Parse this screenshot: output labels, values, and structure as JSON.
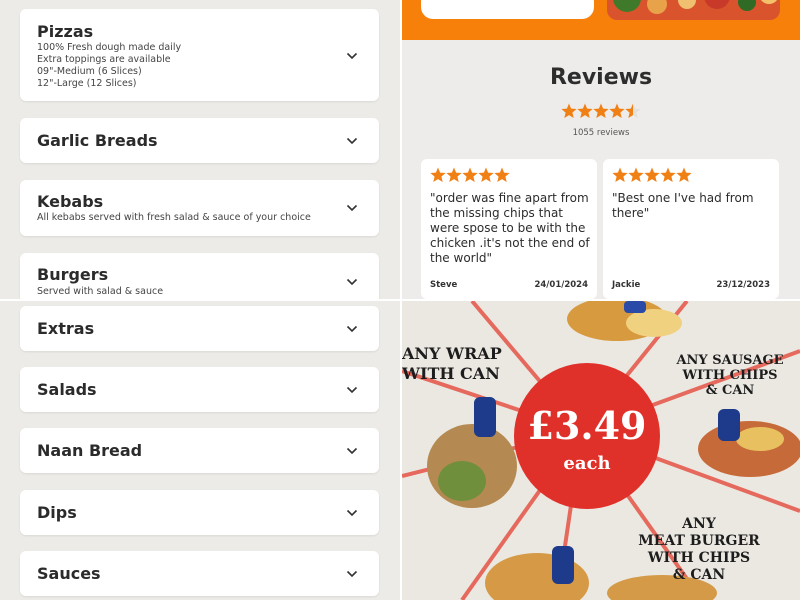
{
  "menu_top": [
    {
      "title": "Pizzas",
      "desc": [
        "100% Fresh dough made daily",
        "Extra toppings are available",
        "09\"-Medium (6 Slices)",
        "12\"-Large (12 Slices)"
      ]
    },
    {
      "title": "Garlic Breads",
      "desc": []
    },
    {
      "title": "Kebabs",
      "desc": [
        "All kebabs served with fresh salad & sauce of your choice"
      ]
    },
    {
      "title": "Burgers",
      "desc": [
        "Served with salad & sauce"
      ]
    }
  ],
  "menu_bottom": [
    {
      "title": "Extras"
    },
    {
      "title": "Salads"
    },
    {
      "title": "Naan Bread"
    },
    {
      "title": "Dips"
    },
    {
      "title": "Sauces"
    }
  ],
  "reviews": {
    "title": "Reviews",
    "rating": 4.5,
    "count_label": "1055 reviews",
    "items": [
      {
        "stars": 5,
        "quote": "\"order was fine apart from the missing chips that were spose to be with the chicken .it's not the end of the world\"",
        "author": "Steve",
        "date": "24/01/2024"
      },
      {
        "stars": 5,
        "quote": "\"Best one I've had from there\"",
        "author": "Jackie",
        "date": "23/12/2023"
      }
    ]
  },
  "promo": {
    "price": "£3.49",
    "price_sub": "each",
    "left_text": [
      "ANY WRAP",
      "WITH CAN"
    ],
    "right_text": [
      "ANY SAUSAGE",
      "WITH CHIPS",
      "& CAN"
    ],
    "bottom_text": [
      "ANY",
      "MEAT BURGER",
      "WITH CHIPS",
      "& CAN"
    ]
  },
  "colors": {
    "accent": "#f7800a",
    "star": "#f07f14",
    "promo_red": "#e0302a",
    "page_bg": "#ecebe7"
  },
  "icons": {
    "chevron": "chevron-down-icon",
    "star": "star-icon"
  }
}
